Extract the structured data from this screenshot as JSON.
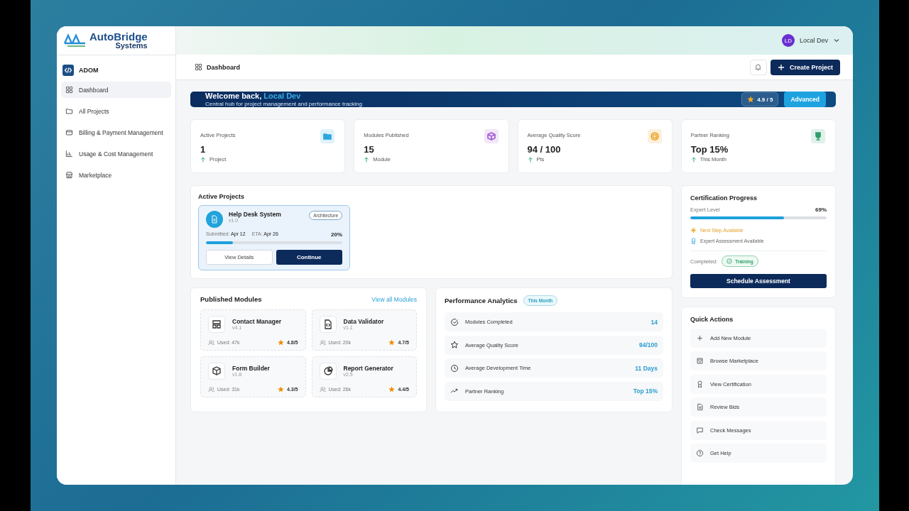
{
  "brand": {
    "name": "AutoBridge",
    "sub": "Systems"
  },
  "workspace": "ADOM",
  "sidebar": {
    "items": [
      {
        "label": "Dashboard",
        "selected": true
      },
      {
        "label": "All Projects",
        "selected": false
      },
      {
        "label": "Billing & Payment Management",
        "selected": false
      },
      {
        "label": "Usage & Cost Management",
        "selected": false
      },
      {
        "label": "Marketplace",
        "selected": false
      }
    ]
  },
  "user": {
    "initials": "LD",
    "name": "Local Dev"
  },
  "breadcrumb": "Dashboard",
  "create_button": "Create Project",
  "welcome": {
    "greeting": "Welcome back,",
    "name": "Local Dev",
    "subtitle": "Central hub for project management and performance tracking",
    "rating": "4.9 / 5",
    "level_badge": "Advanced"
  },
  "stats": [
    {
      "label": "Active Projects",
      "value": "1",
      "unit": "Project",
      "color": "#2ba6de"
    },
    {
      "label": "Modules Published",
      "value": "15",
      "unit": "Module",
      "color": "#a55bd6"
    },
    {
      "label": "Average Quality Score",
      "value": "94 / 100",
      "unit": "Pts",
      "color": "#e9a21f"
    },
    {
      "label": "Partner Ranking",
      "value": "Top 15%",
      "unit": "This Month",
      "color": "#2e9e6a"
    }
  ],
  "active_projects": {
    "title": "Active Projects",
    "projects": [
      {
        "name": "Help Desk System",
        "version": "v1.0",
        "tag": "Architecture",
        "submitted_label": "Submitted:",
        "submitted": "Apr 12",
        "eta_label": "ETA:",
        "eta": "Apr 26",
        "percent": "20%",
        "level": 0.2,
        "buttons": [
          "View Details",
          "Continue"
        ]
      }
    ]
  },
  "published_modules": {
    "title": "Published Modules",
    "link": "View all Modules",
    "modules": [
      {
        "name": "Contact Manager",
        "version": "v4.1",
        "used": "Used: 47k",
        "rating": "4.8/5"
      },
      {
        "name": "Data Validator",
        "version": "v1.1",
        "used": "Used: 20k",
        "rating": "4.7/5"
      },
      {
        "name": "Form Builder",
        "version": "v1.8",
        "used": "Used: 31k",
        "rating": "4.3/5"
      },
      {
        "name": "Report Generator",
        "version": "v2.5",
        "used": "Used: 26k",
        "rating": "4.4/5"
      }
    ]
  },
  "performance": {
    "title": "Performance Analytics",
    "badge": "This Month",
    "rows": [
      {
        "label": "Modules Completed",
        "value": "14"
      },
      {
        "label": "Average Quality Score",
        "value": "94/100"
      },
      {
        "label": "Average Development Time",
        "value": "11 Days"
      },
      {
        "label": "Partner Ranking",
        "value": "Top 15%"
      }
    ]
  },
  "certification": {
    "title": "Certification Progress",
    "level_label": "Expert Level",
    "percent": "69%",
    "level": 0.69,
    "notes": [
      {
        "text": "Next Step Available",
        "kind": "highlight"
      },
      {
        "text": "Expert Assessment Available",
        "kind": "plain"
      }
    ],
    "completed_label": "Completed:",
    "completed_badge": "Training",
    "button": "Schedule Assessment"
  },
  "quick_actions": {
    "title": "Quick Actions",
    "items": [
      "Add New Module",
      "Browse Marketplace",
      "View Certification",
      "Review Bids",
      "Check Messages",
      "Get Help"
    ]
  }
}
